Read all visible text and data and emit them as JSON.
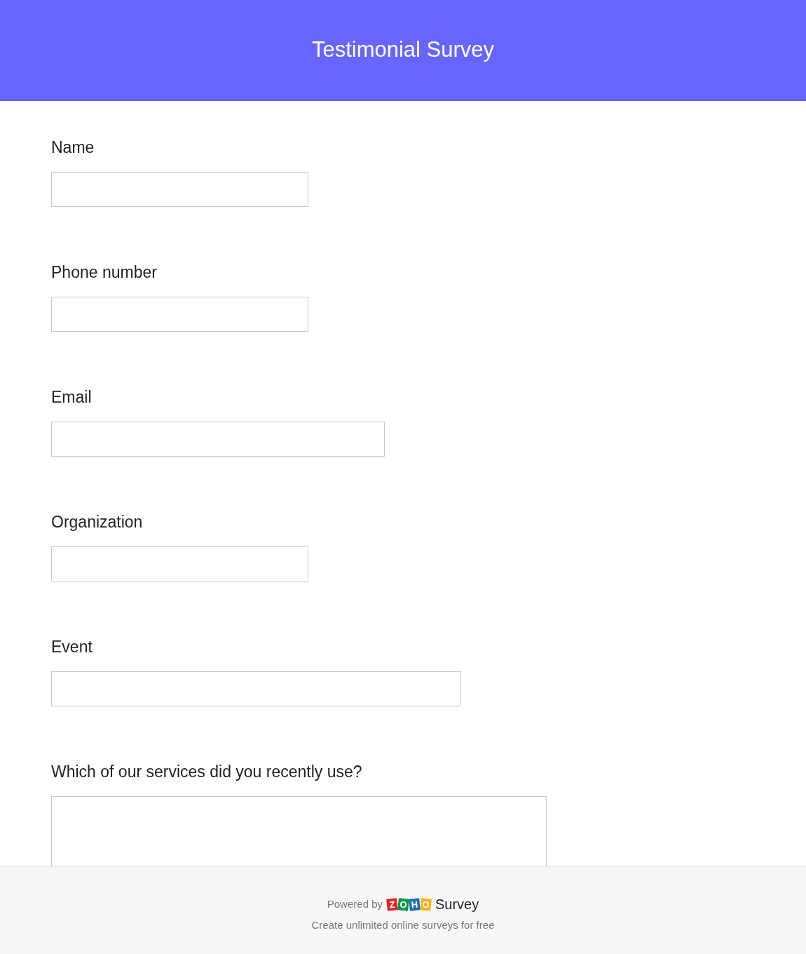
{
  "header": {
    "title": "Testimonial Survey"
  },
  "questions": [
    {
      "label": "Name",
      "kind": "short"
    },
    {
      "label": "Phone number",
      "kind": "short"
    },
    {
      "label": "Email",
      "kind": "medium"
    },
    {
      "label": "Organization",
      "kind": "short"
    },
    {
      "label": "Event",
      "kind": "long"
    },
    {
      "label": "Which of our services did you recently use?",
      "kind": "multiline"
    }
  ],
  "footer": {
    "powered_by": "Powered by",
    "logo_letters": [
      {
        "letter": "Z",
        "color": "#e42527"
      },
      {
        "letter": "O",
        "color": "#089949"
      },
      {
        "letter": "H",
        "color": "#226db4"
      },
      {
        "letter": "O",
        "color": "#f9b21d"
      }
    ],
    "product": "Survey",
    "tagline": "Create unlimited online surveys for free"
  }
}
